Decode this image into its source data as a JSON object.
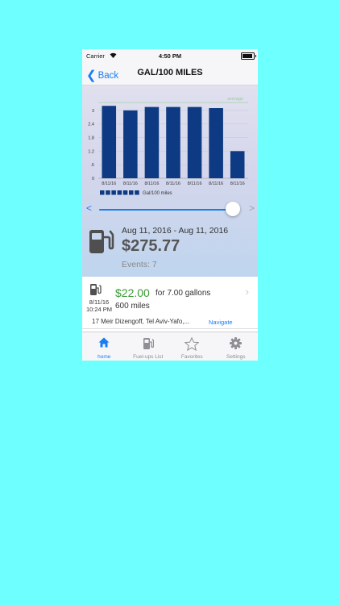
{
  "status_bar": {
    "carrier": "Carrier",
    "time": "4:50 PM"
  },
  "nav": {
    "back_label": "Back",
    "title": "GAL/100 MILES"
  },
  "chart_data": {
    "type": "bar",
    "categories": [
      "8/11/16",
      "8/11/16",
      "8/11/16",
      "8/11/16",
      "8/11/16",
      "8/11/16",
      "8/11/16"
    ],
    "values": [
      3.2,
      3.0,
      3.15,
      3.15,
      3.15,
      3.1,
      1.2
    ],
    "yticks": [
      0,
      0.6,
      1.2,
      1.8,
      2.4,
      3
    ],
    "ytick_labels": [
      "0",
      ".6",
      "1.2",
      "1.8",
      "2.4",
      "3"
    ],
    "ylim": [
      0,
      3.6
    ],
    "average_label": "average",
    "average_value": 3.35,
    "legend_label": "Gal/100 miles",
    "colors": {
      "bar": "#0d3a82",
      "grid": "#c4c6d6",
      "average": "#9bcc9b"
    }
  },
  "slider": {
    "left_arrow": "<",
    "right_arrow": ">",
    "value": 1.0
  },
  "summary": {
    "date_range": "Aug 11, 2016 - Aug 11, 2016",
    "total": "$275.77",
    "events": "Events: 7"
  },
  "list_item": {
    "date": "8/11/16",
    "time": "10:24 PM",
    "price": "$22.00",
    "gallons": "for 7.00 gallons",
    "miles": "600 miles",
    "address": "17 Meir Dizengoff, Tel Aviv-Yafo,...",
    "navigate_label": "Navigate"
  },
  "tabs": [
    {
      "label": "home",
      "icon": "home-icon",
      "active": true
    },
    {
      "label": "Fuel-ups List",
      "icon": "fuel-pump-icon",
      "active": false
    },
    {
      "label": "Favorites",
      "icon": "star-icon",
      "active": false
    },
    {
      "label": "Settings",
      "icon": "gear-icon",
      "active": false
    }
  ]
}
